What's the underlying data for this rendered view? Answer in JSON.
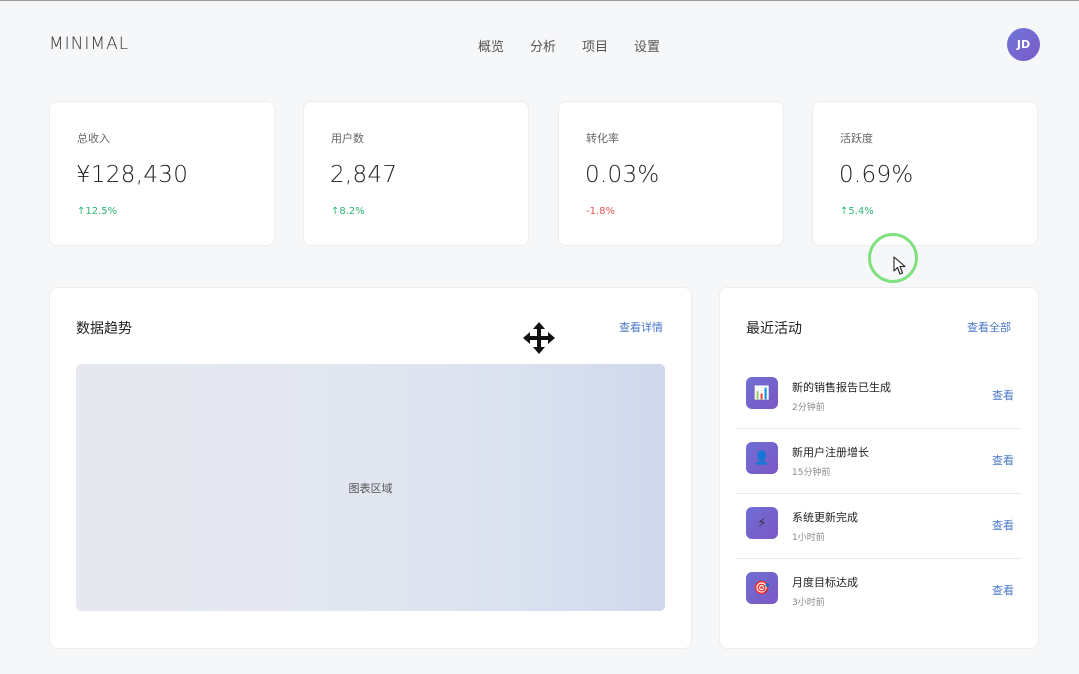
{
  "header": {
    "logo": "MINIMAL",
    "nav": [
      "概览",
      "分析",
      "项目",
      "设置"
    ],
    "avatar_initials": "JD"
  },
  "stats": [
    {
      "label": "总收入",
      "value": "¥128,430",
      "change": "↑12.5%",
      "trend": "up"
    },
    {
      "label": "用户数",
      "value": "2,847",
      "change": "↑8.2%",
      "trend": "up"
    },
    {
      "label": "转化率",
      "value": "0.03%",
      "change": "-1.8%",
      "trend": "down"
    },
    {
      "label": "活跃度",
      "value": "0.69%",
      "change": "↑5.4%",
      "trend": "up"
    }
  ],
  "trend_panel": {
    "title": "数据趋势",
    "link": "查看详情",
    "placeholder": "图表区域"
  },
  "activity_panel": {
    "title": "最近活动",
    "link": "查看全部",
    "items": [
      {
        "icon": "chart-icon",
        "glyph": "📊",
        "title": "新的销售报告已生成",
        "time": "2分钟前",
        "action": "查看"
      },
      {
        "icon": "user-icon",
        "glyph": "👤",
        "title": "新用户注册增长",
        "time": "15分钟前",
        "action": "查看"
      },
      {
        "icon": "lightning-icon",
        "glyph": "⚡",
        "title": "系统更新完成",
        "time": "1小时前",
        "action": "查看"
      },
      {
        "icon": "target-icon",
        "glyph": "🎯",
        "title": "月度目标达成",
        "time": "3小时前",
        "action": "查看"
      }
    ]
  },
  "colors": {
    "accent": "#4a78c9",
    "positive": "#2bb673",
    "negative": "#e05555",
    "icon_gradient_start": "#6e6fd3",
    "icon_gradient_end": "#7c56c4"
  }
}
